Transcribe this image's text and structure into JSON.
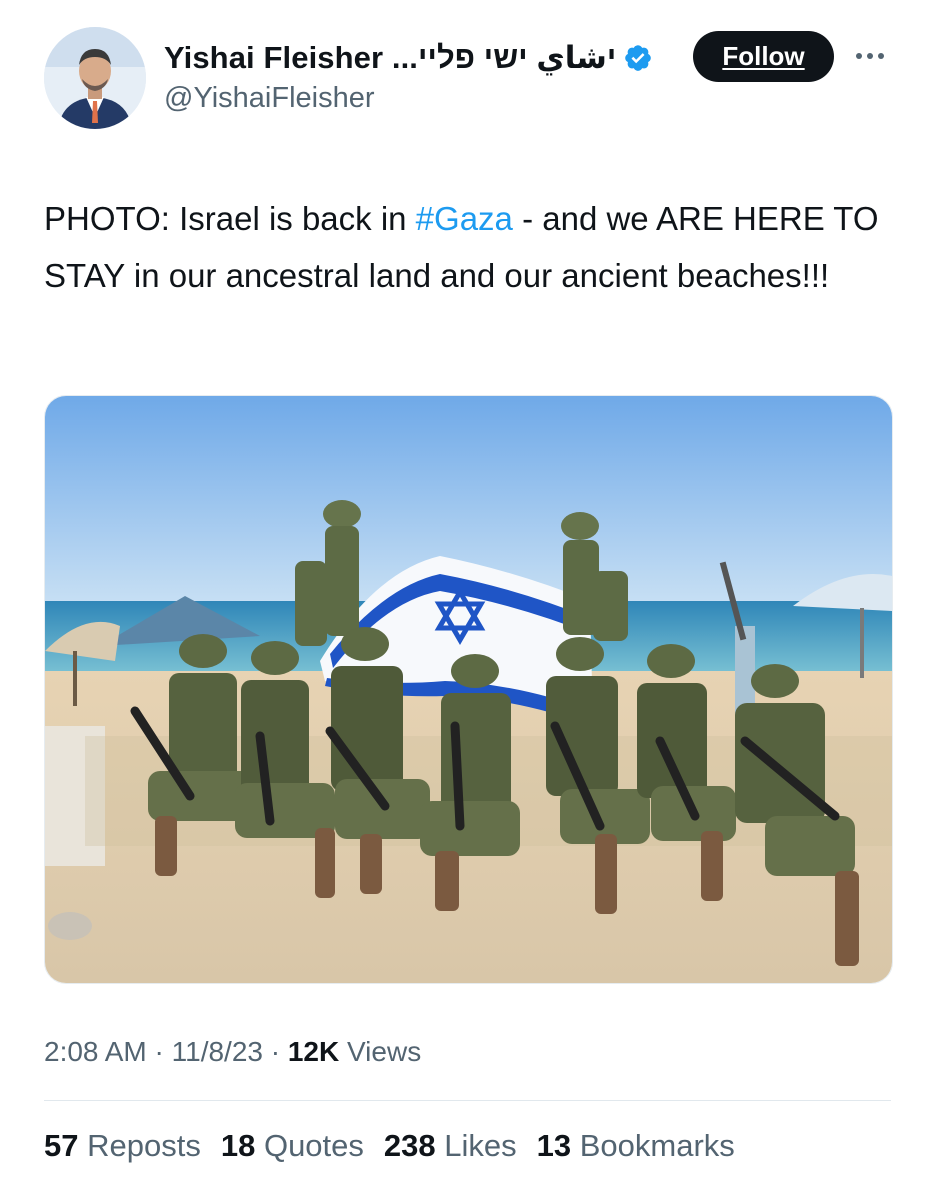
{
  "author": {
    "display_name": "Yishai Fleisher ...יشاي ישי פליי",
    "handle": "@YishaiFleisher",
    "verified": true
  },
  "actions": {
    "follow_label": "Follow",
    "more_icon": "more-horizontal-icon"
  },
  "tweet": {
    "text_before": "PHOTO: Israel is back in ",
    "hashtag": "#Gaza",
    "text_after": " - and we ARE HERE TO STAY in our ancestral land and our ancient beaches!!!"
  },
  "meta": {
    "time": "2:08 AM",
    "sep1": " · ",
    "date": "11/8/23",
    "sep2": " · ",
    "views_count": "12K",
    "views_label": " Views"
  },
  "stats": {
    "reposts": {
      "count": "57",
      "label": "Reposts"
    },
    "quotes": {
      "count": "18",
      "label": "Quotes"
    },
    "likes": {
      "count": "238",
      "label": "Likes"
    },
    "bookmarks": {
      "count": "13",
      "label": "Bookmarks"
    }
  },
  "colors": {
    "accent": "#1d9bf0",
    "text": "#0f1419",
    "muted": "#536471",
    "follow_bg": "#0f1419"
  }
}
